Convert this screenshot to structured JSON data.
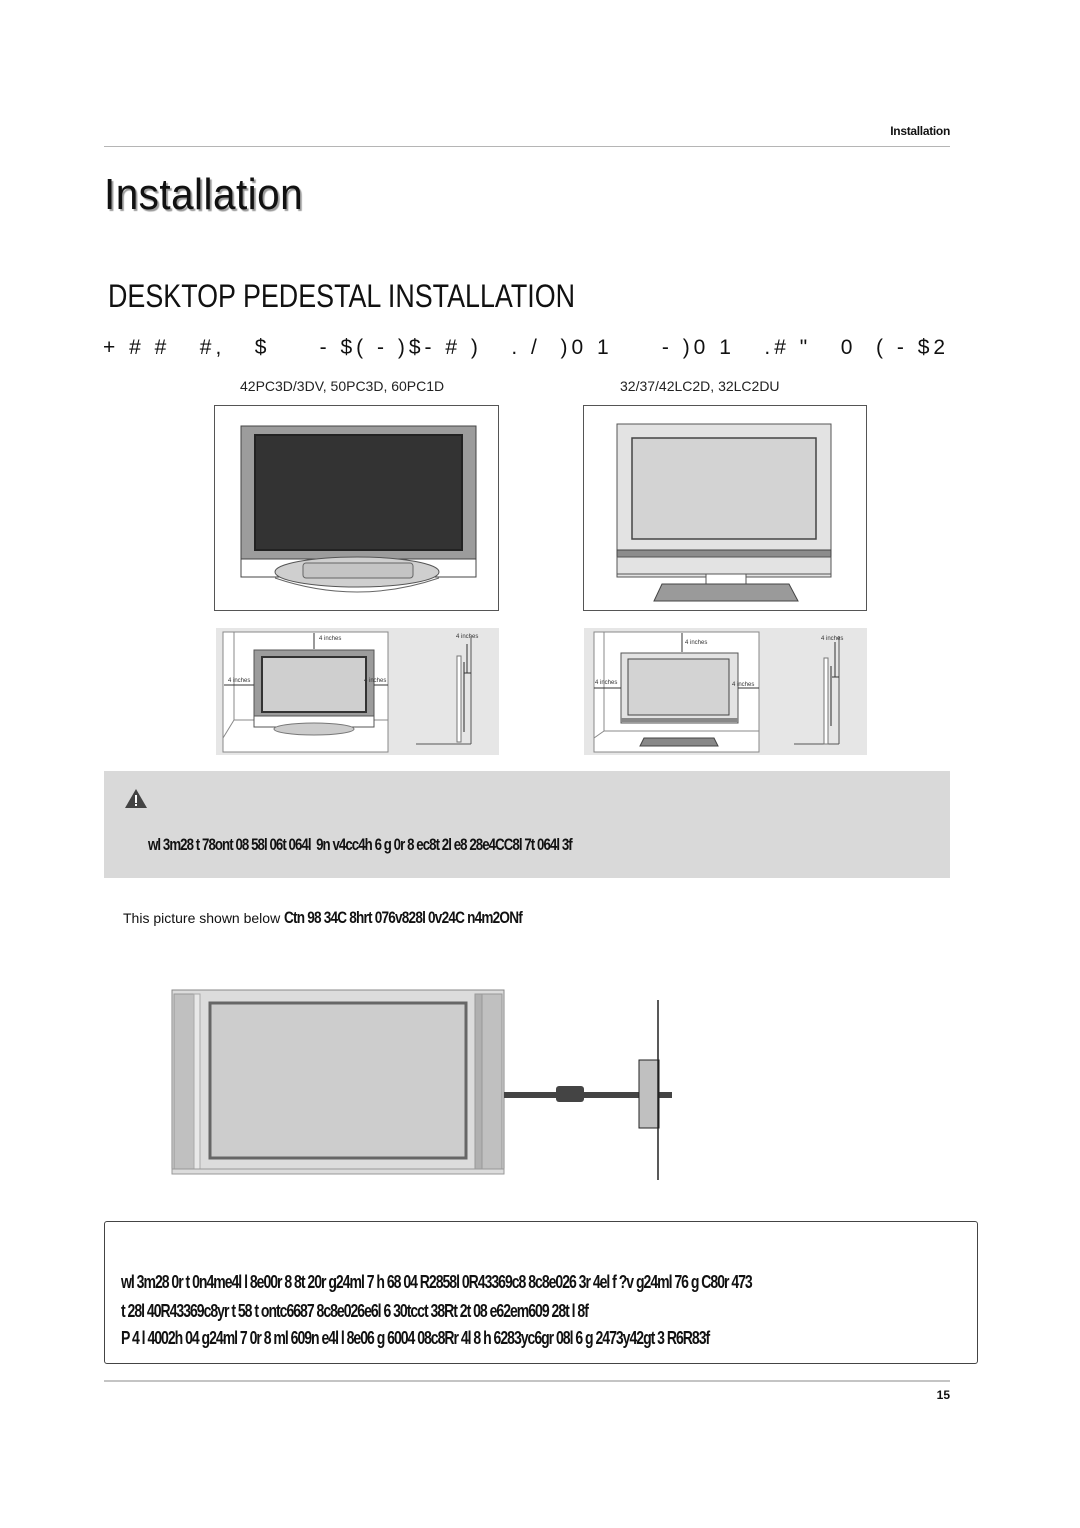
{
  "header": {
    "running_title": "Installation",
    "page_title": "Installation"
  },
  "section": {
    "title": "DESKTOP PEDESTAL INSTALLATION",
    "garbled_intro": "+ # #   #,   $     - $( - )$- # )   . /  )0 1     - )0 1   .# \"   0  ( - $2"
  },
  "figures": {
    "left_model_label": "42PC3D/3DV, 50PC3D, 60PC1D",
    "right_model_label": "32/37/42LC2D, 32LC2DU",
    "clearance_label": "4 inches"
  },
  "warning": {
    "icon": "warning-triangle-icon",
    "text": "wl 3m28 t 78ont 08 58l 06t 064l  9n v4cc4h 6 g 0r 8 ec8t 2l e8 28e4CC8l 7t 064l 3f"
  },
  "caption": {
    "plain": "This picture shown below ",
    "garbled": "Ctn 98 34C 8hrt 076v828l 0v24C n4m2ONf"
  },
  "note": {
    "lines": [
      "wl 3m28 0r t 0n4me4l l 8e00r 8 8t 20r g24ml 7 h 68 04 R2858l 0R43369c8 8c8e026 3r 4el f ?v g24ml 76 g C80r 473",
      "t 28l 40R43369c8yr t 58 t ontc6687 8c8e026e6l 6 30tcct 38Rt 2t 08 e62em609 28t l 8f",
      "P 4 l 4002h 04 g24ml 7 0r 8 ml 609n e4l l 8e06 g 6004 08c8Rr 4l 8 h 6283yc6gr 08l 6 g 2473y42gt 3 R6R83f"
    ]
  },
  "footer": {
    "page_number": "15"
  },
  "colors": {
    "warning_bg": "#d9d9d9",
    "rule": "#b5b5b5",
    "plasma_screen": "#333333",
    "lcd_screen": "#d3d3d3"
  }
}
